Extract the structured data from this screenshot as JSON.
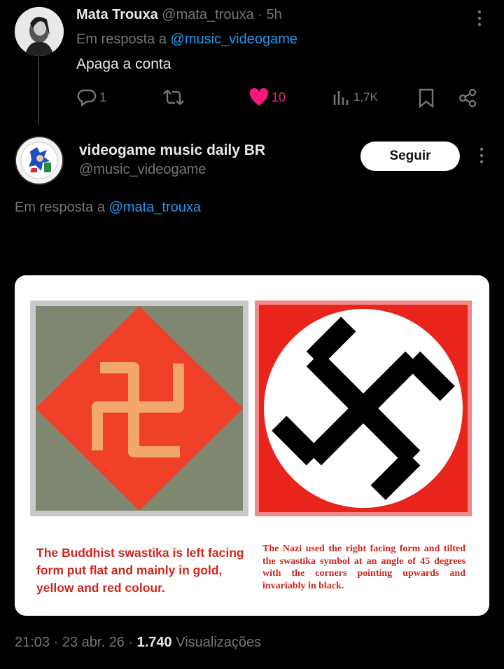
{
  "reply_tweet": {
    "name": "Mata Trouxa",
    "handle": "@mata_trouxa",
    "separator": "·",
    "time": "5h",
    "replying_prefix": "Em resposta a",
    "replying_to": "@music_videogame",
    "text": "Apaga a conta",
    "actions": {
      "replies": "1",
      "retweets": "",
      "likes": "10",
      "views": "1,7K"
    },
    "like_color": "#f91880"
  },
  "main_tweet": {
    "name": "videogame music daily BR",
    "handle": "@music_videogame",
    "follow_label": "Seguir",
    "replying_prefix": "Em resposta a",
    "replying_to": "@mata_trouxa",
    "image": {
      "left_caption": "The Buddhist swastika is left facing form put flat and mainly in gold, yellow and red colour.",
      "right_caption": "The Nazi used the right facing form and tilted the swastika symbol at an angle of 45 degrees with the corners pointing upwards and invariably in black."
    },
    "footer": {
      "time": "21:03",
      "sep1": "·",
      "date": "23 abr. 26",
      "sep2": "·",
      "views_count": "1.740",
      "views_label": "Visualizações"
    }
  },
  "colors": {
    "link": "#1d9bf0",
    "muted": "#71767b",
    "caption_red": "#d0261f"
  }
}
